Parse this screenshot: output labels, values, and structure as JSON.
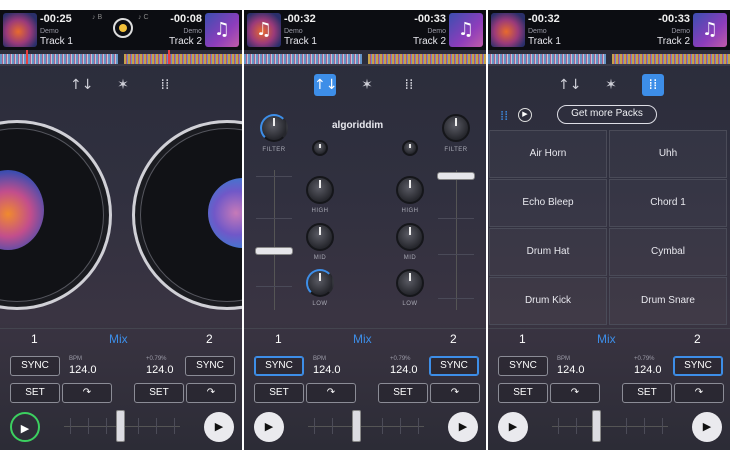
{
  "screens": [
    {
      "header": {
        "deck1": {
          "time": "-00:25",
          "artist": "Demo",
          "track": "Track 1",
          "marker": "♪ B"
        },
        "deck2": {
          "time": "-00:08",
          "artist": "Demo",
          "track": "Track 2",
          "marker": "♪ C"
        }
      },
      "active_tab": "decks"
    },
    {
      "header": {
        "deck1": {
          "time": "-00:32",
          "artist": "Demo",
          "track": "Track 1"
        },
        "deck2": {
          "time": "-00:33",
          "artist": "Demo",
          "track": "Track 2"
        }
      },
      "active_tab": "eq",
      "logo": "algoriddim",
      "eq_labels": {
        "filter": "FILTER",
        "high": "HIGH",
        "mid": "MID",
        "low": "LOW"
      }
    },
    {
      "header": {
        "deck1": {
          "time": "-00:32",
          "artist": "Demo",
          "track": "Track 1"
        },
        "deck2": {
          "time": "-00:33",
          "artist": "Demo",
          "track": "Track 2"
        }
      },
      "active_tab": "sampler",
      "get_more": "Get more Packs",
      "pads": [
        "Air Horn",
        "Uhh",
        "Echo Bleep",
        "Chord 1",
        "Drum Hat",
        "Cymbal",
        "Drum Kick",
        "Drum Snare"
      ]
    }
  ],
  "controls": {
    "deck1_number": "1",
    "deck2_number": "2",
    "mix_label": "Mix",
    "sync_label": "SYNC",
    "set_label": "SET",
    "bpm_label": "BPM",
    "bpm_value": "124.0",
    "pitch_offset": "+0.79%",
    "bpm_value2": "124.0"
  },
  "icons": {
    "record": "record-dot-icon",
    "eq_tab": "eq-sliders-icon",
    "fx_tab": "waveform-fx-icon",
    "grid_tab": "grid-icon",
    "play": "play-icon",
    "cue": "cue-arrow-icon"
  },
  "colors": {
    "accent": "#3d8ee8",
    "play_active": "#3cd060",
    "record": "#f2c03a"
  }
}
